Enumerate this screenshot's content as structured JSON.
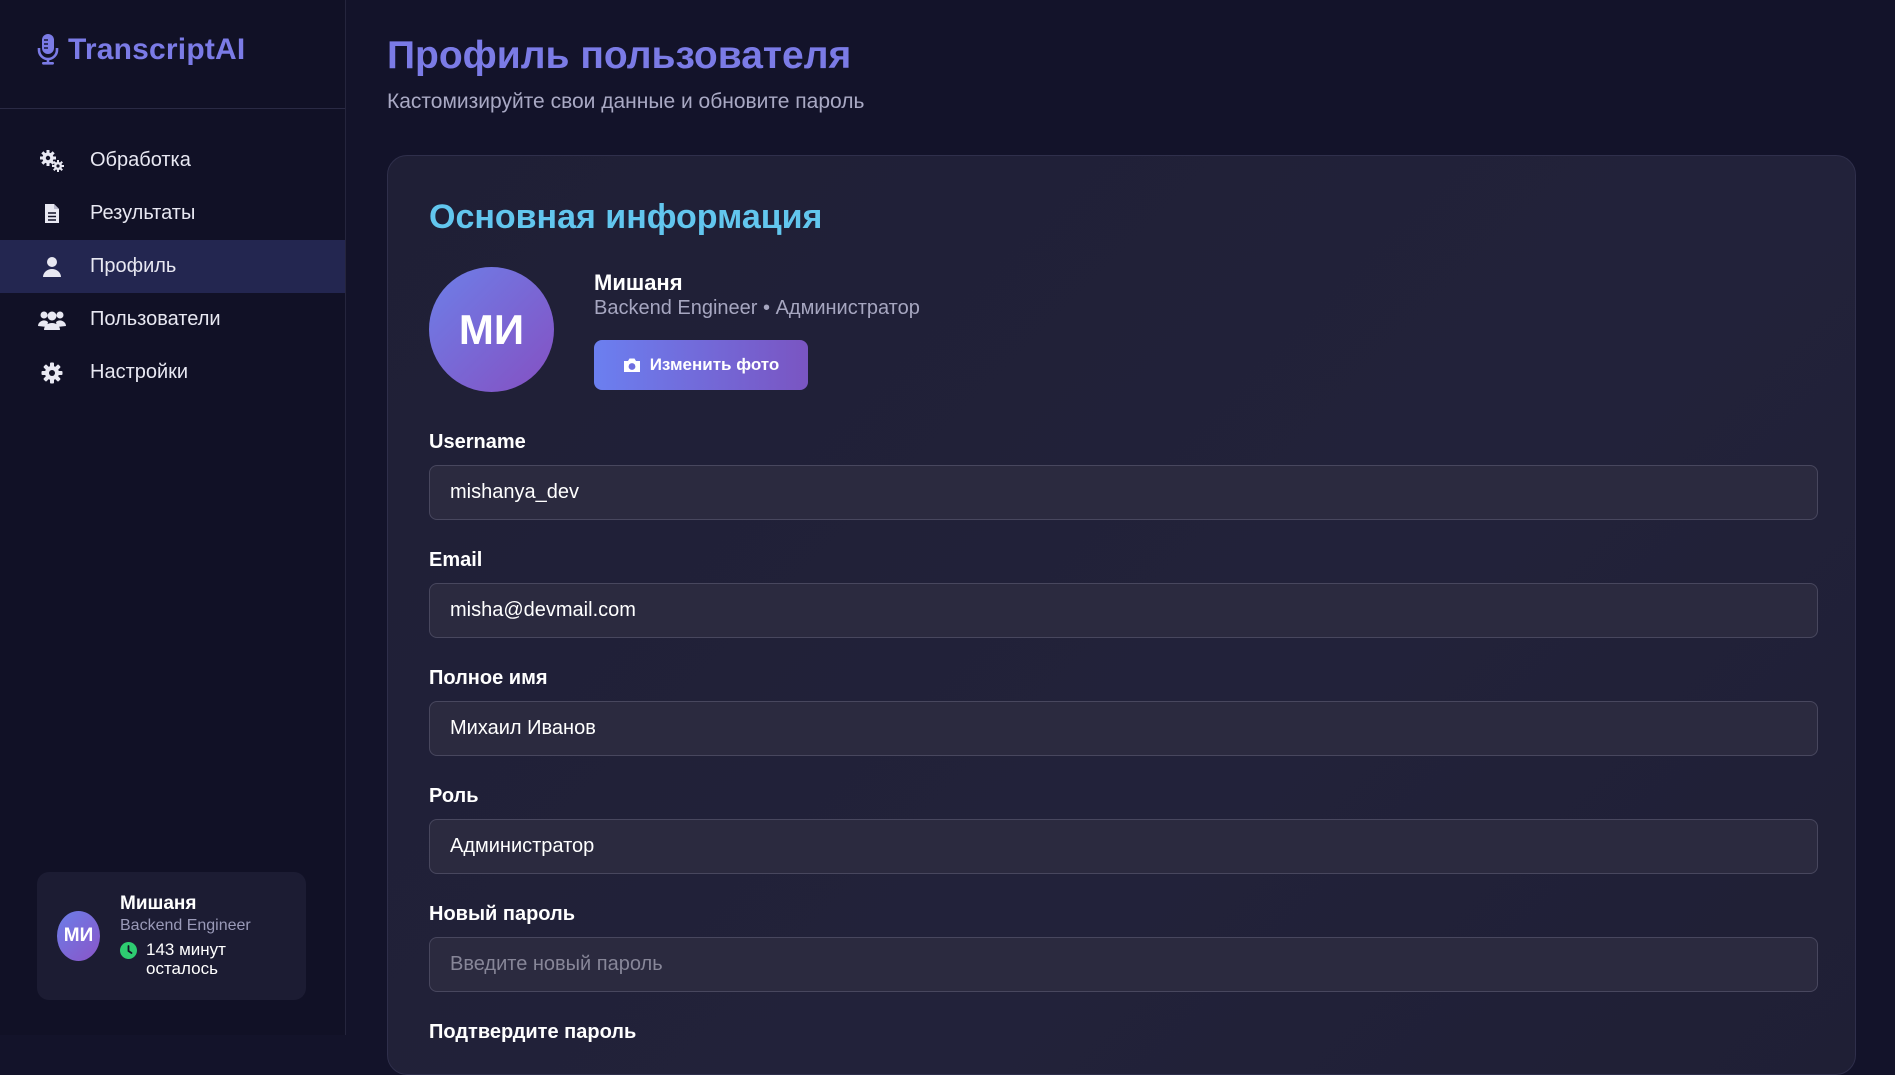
{
  "app": {
    "name": "TranscriptAI",
    "icon": "microphone-icon"
  },
  "sidebar": {
    "items": [
      {
        "label": "Обработка",
        "icon": "gears-icon",
        "active": false
      },
      {
        "label": "Результаты",
        "icon": "document-icon",
        "active": false
      },
      {
        "label": "Профиль",
        "icon": "user-icon",
        "active": true
      },
      {
        "label": "Пользователи",
        "icon": "users-icon",
        "active": false
      },
      {
        "label": "Настройки",
        "icon": "gear-icon",
        "active": false
      }
    ],
    "user_card": {
      "initials": "МИ",
      "name": "Мишаня",
      "role": "Backend Engineer",
      "time_left": "143 минут осталось"
    }
  },
  "header": {
    "title": "Профиль пользователя",
    "subtitle": "Кастомизируйте свои данные и обновите пароль"
  },
  "profile": {
    "section_title": "Основная информация",
    "initials": "МИ",
    "name": "Мишаня",
    "role_line": "Backend Engineer • Администратор",
    "change_photo_label": "Изменить фото",
    "fields": {
      "username": {
        "label": "Username",
        "value": "mishanya_dev"
      },
      "email": {
        "label": "Email",
        "value": "misha@devmail.com"
      },
      "full_name": {
        "label": "Полное имя",
        "value": "Михаил Иванов"
      },
      "role": {
        "label": "Роль",
        "value": "Администратор"
      },
      "new_password": {
        "label": "Новый пароль",
        "value": "",
        "placeholder": "Введите новый пароль"
      },
      "confirm_password": {
        "label": "Подтвердите пароль"
      }
    }
  },
  "colors": {
    "accent": "#7b7be6",
    "section_title": "#62c6ee",
    "active_nav": "#232650",
    "status_green": "#2ecc71"
  }
}
